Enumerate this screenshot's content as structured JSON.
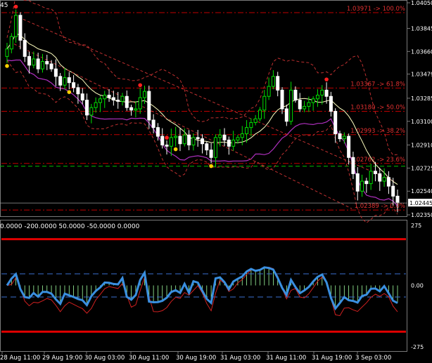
{
  "window": {
    "title_fragment": "45"
  },
  "colors": {
    "background": "#000000",
    "bull_candle": "#00e000",
    "bear_candle": "#ffffff",
    "fib_line": "#c00000",
    "fib_text": "#e03030",
    "bollinger_mid": "#ffffc0",
    "bollinger_band": "#c03030",
    "purple_line": "#b030c0",
    "green_dash": "#00c000",
    "cci_line": "#3a8fe0",
    "cci_thin": "#d02020",
    "cci_level": "#e00000",
    "axis_text": "#ffffff"
  },
  "price_axis": {
    "ylim": [
      1.0235,
      1.0405
    ],
    "labels": [
      "1.04050",
      "1.03845",
      "1.03660",
      "1.03479",
      "1.03285",
      "1.03100",
      "1.02910",
      "1.02725",
      "1.02540",
      "1.02350"
    ],
    "current_price": "1.02445"
  },
  "fib_levels": [
    {
      "price": 1.03971,
      "label": "1.03971 -> 100.0%"
    },
    {
      "price": 1.03367,
      "label": "1.03367 -> 61.8%"
    },
    {
      "price": 1.0318,
      "label": "1.03180 -> 50.0%"
    },
    {
      "price": 1.02993,
      "label": "1.02993 -> 38.2%"
    },
    {
      "price": 1.02762,
      "label": "1.02762 -> 23.6%"
    },
    {
      "price": 1.02389,
      "label": "1.02389 -> 0.0%"
    }
  ],
  "indicator": {
    "label": "0.0000 -200.0000 50.0000 -50.0000 0.0000",
    "axis_labels": [
      "275",
      "0.00",
      "-275"
    ],
    "ylim": [
      -275,
      275
    ],
    "upper_level": 200,
    "lower_level": -200,
    "dash_levels": [
      50,
      -50
    ]
  },
  "time_axis": {
    "labels": [
      "28 Aug 11:00",
      "29 Aug 19:00",
      "30 Aug 03:00",
      "30 Aug 11:00",
      "30 Aug 19:00",
      "31 Aug 03:00",
      "31 Aug 11:00",
      "31 Aug 19:00",
      "3 Sep 03:00"
    ]
  },
  "chart_data": {
    "type": "candlestick",
    "ylim": [
      1.0235,
      1.0405
    ],
    "closes": [
      1.0368,
      1.0378,
      1.0395,
      1.0375,
      1.0362,
      1.0355,
      1.036,
      1.0352,
      1.0358,
      1.0356,
      1.0352,
      1.0346,
      1.0339,
      1.0345,
      1.0341,
      1.0337,
      1.0332,
      1.0327,
      1.0315,
      1.0321,
      1.0325,
      1.0328,
      1.0331,
      1.0329,
      1.0327,
      1.0326,
      1.033,
      1.0321,
      1.0319,
      1.032,
      1.0329,
      1.0334,
      1.0311,
      1.0305,
      1.0298,
      1.0291,
      1.029,
      1.0297,
      1.0298,
      1.0292,
      1.0299,
      1.0291,
      1.0297,
      1.0296,
      1.0292,
      1.0287,
      1.0281,
      1.0297,
      1.0299,
      1.0295,
      1.029,
      1.0295,
      1.0297,
      1.03,
      1.0305,
      1.0309,
      1.0312,
      1.0319,
      1.033,
      1.0338,
      1.0346,
      1.0335,
      1.032,
      1.031,
      1.0335,
      1.0327,
      1.032,
      1.0322,
      1.0325,
      1.0328,
      1.0331,
      1.0335,
      1.033,
      1.0318,
      1.03,
      1.0296,
      1.0298,
      1.0281,
      1.0268,
      1.0254,
      1.0262,
      1.026,
      1.027,
      1.0268,
      1.0262,
      1.0265,
      1.0258,
      1.025,
      1.0245
    ]
  }
}
